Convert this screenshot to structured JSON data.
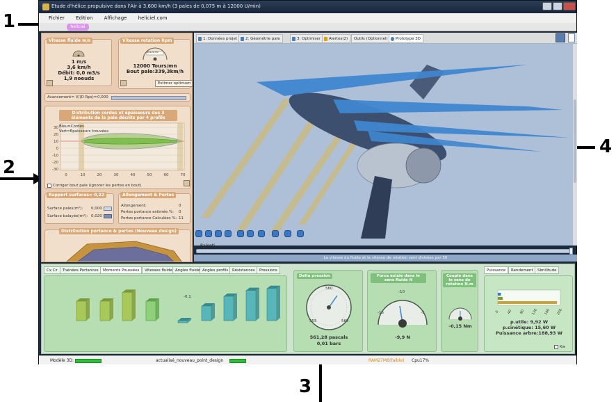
{
  "window": {
    "title": "Etude d'hélice propulsive dans l'Air à 3,600 km/h (3 pales de 0,075 m à 12000 U/min)",
    "menu": [
      "Fichier",
      "Edition",
      "Affichage",
      "heliciel.com"
    ]
  },
  "annotations": [
    "1",
    "2",
    "3",
    "4"
  ],
  "left": {
    "vitesse_fluide": {
      "title": "Vitesse fluide m/s",
      "speed": "1 m/s",
      "kmh": "3,6 km/h",
      "debit": "Débit: 0,0 m3/s",
      "noeuds": "1,9 noeuds"
    },
    "vitesse_rotation": {
      "title": "Vitesse rotation Rpm",
      "digits": "00120.00",
      "tours": "12000 Tours/mn",
      "bout_pale": "Bout pale:339,3km/h",
      "button": "Estimer optimum"
    },
    "avancement": {
      "label": "Avancement= V/(D Rps)=",
      "value": "0,000"
    },
    "distribution": {
      "title": "Distribution cordes et épaisseurs des 3 éléments de la pale décrits par 4 profils",
      "legend_bleu": "Bleu=Cordes",
      "legend_vert": "Vert=Epaisseurs trouvées",
      "y_ticks": [
        "30",
        "20",
        "10",
        "0",
        "-10",
        "-20",
        "-30"
      ],
      "x_ticks": [
        "0",
        "10",
        "20",
        "30",
        "40",
        "50",
        "60",
        "70"
      ],
      "checkbox": "Corriger bout pale (ignorer les pertes en bout)"
    },
    "rapport": {
      "title": "Rapport surfaces= 0,22",
      "surface_pales": "Surface pales(m²):",
      "surface_pales_val": "0,000",
      "surface_balayee": "Surface balayée(m²):",
      "surface_balayee_val": "0,020"
    },
    "allongement": {
      "title": "Allongement & Pertes",
      "allongement": "Allongement:",
      "allongement_val": "0",
      "pertes_estimees": "Pertes portance estimée %:",
      "pertes_estimees_val": "0",
      "pertes_calculees": "Pertes portance Calculées %:",
      "pertes_calculees_val": "11"
    },
    "distribution_portance": {
      "title": "Distribution portance & pertes (Nouveau design)"
    }
  },
  "view_tabs": [
    "1: Données projet",
    "2: Géométrie pale",
    "3: Optimiser",
    "Alertes(2)",
    "Outils (Optionnel)",
    "Prototype 3D"
  ],
  "view": {
    "ralenti": "Ralenti",
    "status": "La vitesse du fluide et la vitesse de rotation sont divisées par 50",
    "colors": {
      "background": "#aebfd8",
      "blade": "#3f86d0",
      "hub": "#3c4f6e",
      "shaft": "#c6ba8a"
    }
  },
  "bottom_tabs": [
    "Cx Cz",
    "Trainées Portances",
    "Moments Poussées",
    "Vitesses fluide",
    "Angles fluide",
    "Angles profils",
    "Résistances",
    "Pressions"
  ],
  "bottom": {
    "bar_label": "-0,1",
    "bar_values": [
      4.0,
      4.0,
      5.8,
      4.0,
      -0.1,
      3.0,
      5.0,
      6.2,
      6.6
    ],
    "delta_pression": {
      "title": "Delta pression",
      "ticks": [
        "560",
        "555",
        "565"
      ],
      "value": "561,28 pascals",
      "bars": "0,01 bars"
    },
    "force_axiale": {
      "title": "Force axiale dans le sens fluide N",
      "ticks": [
        "-10",
        "-15",
        "-5"
      ],
      "value": "-9,9 N"
    },
    "couple": {
      "title": "Couple dans le sens de rotation N.m",
      "value": "-0,15 Nm"
    },
    "right_tabs": [
      "Puissance",
      "Rendement",
      "Similitude"
    ],
    "puissance": {
      "x_ticks": [
        "0",
        "40",
        "80",
        "120",
        "160",
        "200"
      ],
      "p_utile": "p.utile: 9,92 W",
      "p_cinetique": "p.cinétique: 15,60 W",
      "p_arbre": "Puissance arbre:188,93 W",
      "kw": "Kw",
      "bar_values": [
        9.92,
        15.6,
        188.93
      ],
      "x_max": 200
    }
  },
  "statusbar": {
    "modele": "Modèle 3D:",
    "actualise": "actualisé_nouveau_point_design",
    "ram": "RAM27MB(faible)",
    "cpu": "Cpu17%"
  }
}
